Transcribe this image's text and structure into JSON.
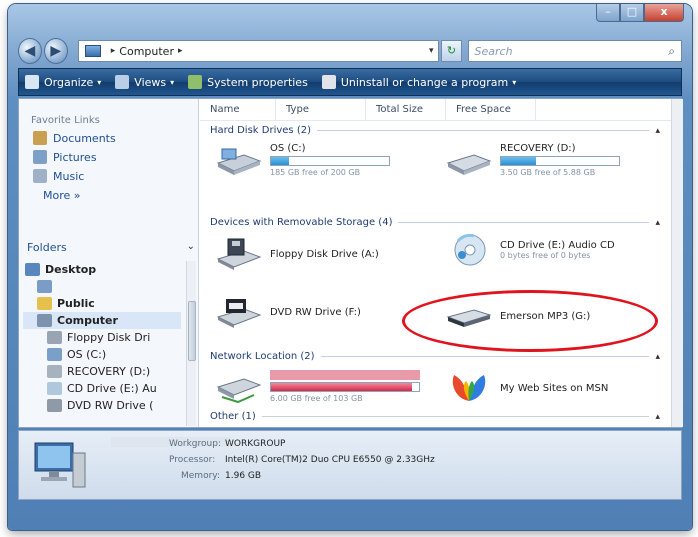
{
  "titlebar": {
    "minimize": "–",
    "maximize": "□",
    "close": "x"
  },
  "address": {
    "crumbs": [
      "Computer"
    ],
    "separator": "▸",
    "drop": "▾",
    "refresh": "↻",
    "search_placeholder": "Search",
    "search_icon": "⌕"
  },
  "toolbar": {
    "items": [
      {
        "label": "Organize",
        "color": "#d8e6f3"
      },
      {
        "label": "Views",
        "color": "#b8cfe6"
      },
      {
        "label": "System properties",
        "color": "#8fbf6a"
      },
      {
        "label": "Uninstall or change a program",
        "color": "#e0e4e8"
      }
    ],
    "dropdown_arrow": "▾"
  },
  "nav": {
    "favorites_heading": "Favorite Links",
    "favorites": [
      {
        "label": "Documents",
        "color": "#c9a052"
      },
      {
        "label": "Pictures",
        "color": "#7da0c9"
      },
      {
        "label": "Music",
        "color": "#9fb0c9"
      }
    ],
    "more": "More »",
    "folders_heading": "Folders",
    "folders_chevron": "⌄",
    "tree": [
      {
        "label": "Desktop",
        "indent": 0,
        "color": "#5a86c0"
      },
      {
        "label": "",
        "indent": 1,
        "color": "#7b9cc7"
      },
      {
        "label": "Public",
        "indent": 1,
        "color": "#e6c04c"
      },
      {
        "label": "Computer",
        "indent": 1,
        "color": "#7d93ad"
      },
      {
        "label": "Floppy Disk Dri",
        "indent": 2,
        "color": "#9aa5b3"
      },
      {
        "label": "OS (C:)",
        "indent": 2,
        "color": "#7aa0c9"
      },
      {
        "label": "RECOVERY (D:)",
        "indent": 2,
        "color": "#a7b2bf"
      },
      {
        "label": "CD Drive (E:) Au",
        "indent": 2,
        "color": "#b0c8dc"
      },
      {
        "label": "DVD RW Drive (",
        "indent": 2,
        "color": "#8f9aa8"
      }
    ]
  },
  "columns": [
    "Name",
    "Type",
    "Total Size",
    "Free Space"
  ],
  "groups": [
    {
      "label": "Hard Disk Drives (2)",
      "collapse": "▴"
    },
    {
      "label": "Devices with Removable Storage (4)",
      "collapse": "▴"
    },
    {
      "label": "Network Location (2)",
      "collapse": "▴"
    },
    {
      "label": "Other (1)",
      "collapse": "▴"
    }
  ],
  "drives": {
    "os": {
      "label": "OS (C:)",
      "free": "185 GB free of 200 GB",
      "usage": 0.15
    },
    "recovery": {
      "label": "RECOVERY (D:)",
      "free": "3.50 GB free of 5.88 GB",
      "usage": 0.3
    },
    "floppy": {
      "label": "Floppy Disk Drive (A:)"
    },
    "cd": {
      "label": "CD Drive (E:) Audio CD",
      "sub": "0 bytes free of 0 bytes"
    },
    "dvd": {
      "label": "DVD RW Drive (F:)"
    },
    "emerson": {
      "label": "Emerson MP3 (G:)"
    },
    "network": {
      "label": "",
      "free": "6.00 GB free of 103 GB",
      "usage": 0.95
    },
    "msn": {
      "label": "My Web Sites on MSN"
    }
  },
  "details": {
    "name": "",
    "workgroup_label": "Workgroup:",
    "workgroup": "WORKGROUP",
    "processor_label": "Processor:",
    "processor": "Intel(R) Core(TM)2 Duo CPU   E6550  @ 2.33GHz",
    "memory_label": "Memory:",
    "memory": "1.96 GB"
  }
}
